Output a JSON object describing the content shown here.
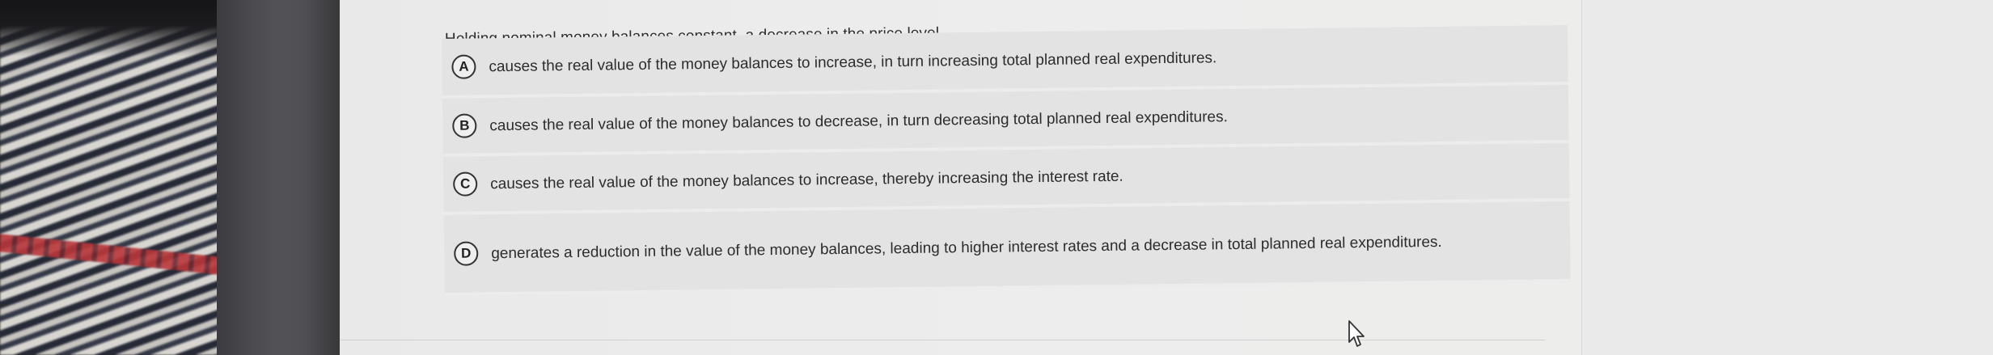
{
  "question": {
    "prompt": "Holding nominal money balances constant, a decrease in the price level",
    "options": [
      {
        "letter": "A",
        "text": "causes the real value of the money balances to increase, in turn increasing total planned real expenditures."
      },
      {
        "letter": "B",
        "text": "causes the real value of the money balances to decrease, in turn decreasing total planned real expenditures."
      },
      {
        "letter": "C",
        "text": "causes the real value of the money balances to increase, thereby increasing the interest rate."
      },
      {
        "letter": "D",
        "text": "generates a reduction in the value of the money balances, leading to higher interest rates and a decrease in total planned real expenditures."
      }
    ]
  },
  "icons": {
    "cursor": "mouse-pointer-icon"
  },
  "colors": {
    "option_background": "#e3e3e3",
    "screen_background": "#ececec",
    "text": "#2c2c2c"
  }
}
